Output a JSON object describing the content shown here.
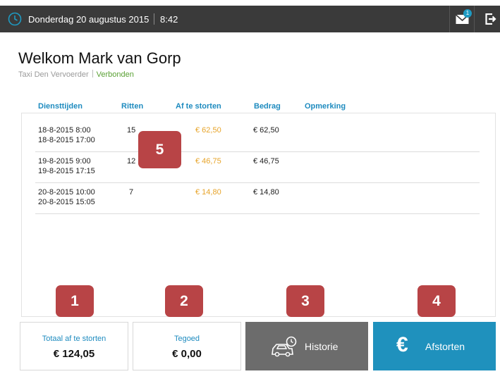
{
  "topbar": {
    "date": "Donderdag 20 augustus 2015",
    "time": "8:42",
    "mail_badge": "1"
  },
  "header": {
    "welcome": "Welkom Mark van Gorp",
    "company": "Taxi Den Vervoerder",
    "status": "Verbonden"
  },
  "table": {
    "columns": [
      "Diensttijden",
      "Ritten",
      "Af te storten",
      "Bedrag",
      "Opmerking"
    ],
    "rows": [
      {
        "start": "18-8-2015 8:00",
        "end": "18-8-2015 17:00",
        "ritten": "15",
        "af_te_storten": "€ 62,50",
        "bedrag": "€ 62,50",
        "opmerking": ""
      },
      {
        "start": "19-8-2015 9:00",
        "end": "19-8-2015 17:15",
        "ritten": "12",
        "af_te_storten": "€ 46,75",
        "bedrag": "€ 46,75",
        "opmerking": ""
      },
      {
        "start": "20-8-2015 10:00",
        "end": "20-8-2015 15:05",
        "ritten": "7",
        "af_te_storten": "€ 14,80",
        "bedrag": "€ 14,80",
        "opmerking": ""
      }
    ]
  },
  "summary": {
    "totaal_label": "Totaal af te storten",
    "totaal_value": "€ 124,05",
    "tegoed_label": "Tegoed",
    "tegoed_value": "€ 0,00"
  },
  "buttons": {
    "historie": "Historie",
    "afstorten": "Afstorten"
  },
  "annotations": [
    "1",
    "2",
    "3",
    "4",
    "5"
  ],
  "colors": {
    "topbar": "#3a3a3a",
    "accent_blue": "#1e8bbf",
    "amount_orange": "#e7a42a",
    "status_green": "#59a033",
    "annotation_red": "#b84446",
    "historie_grey": "#6c6c6c",
    "afstorten_blue": "#1f91bd"
  },
  "icons": {
    "clock": "clock-icon",
    "mail": "mail-icon",
    "logout": "logout-icon",
    "historie": "car-clock-icon",
    "afstorten": "euro-icon"
  }
}
